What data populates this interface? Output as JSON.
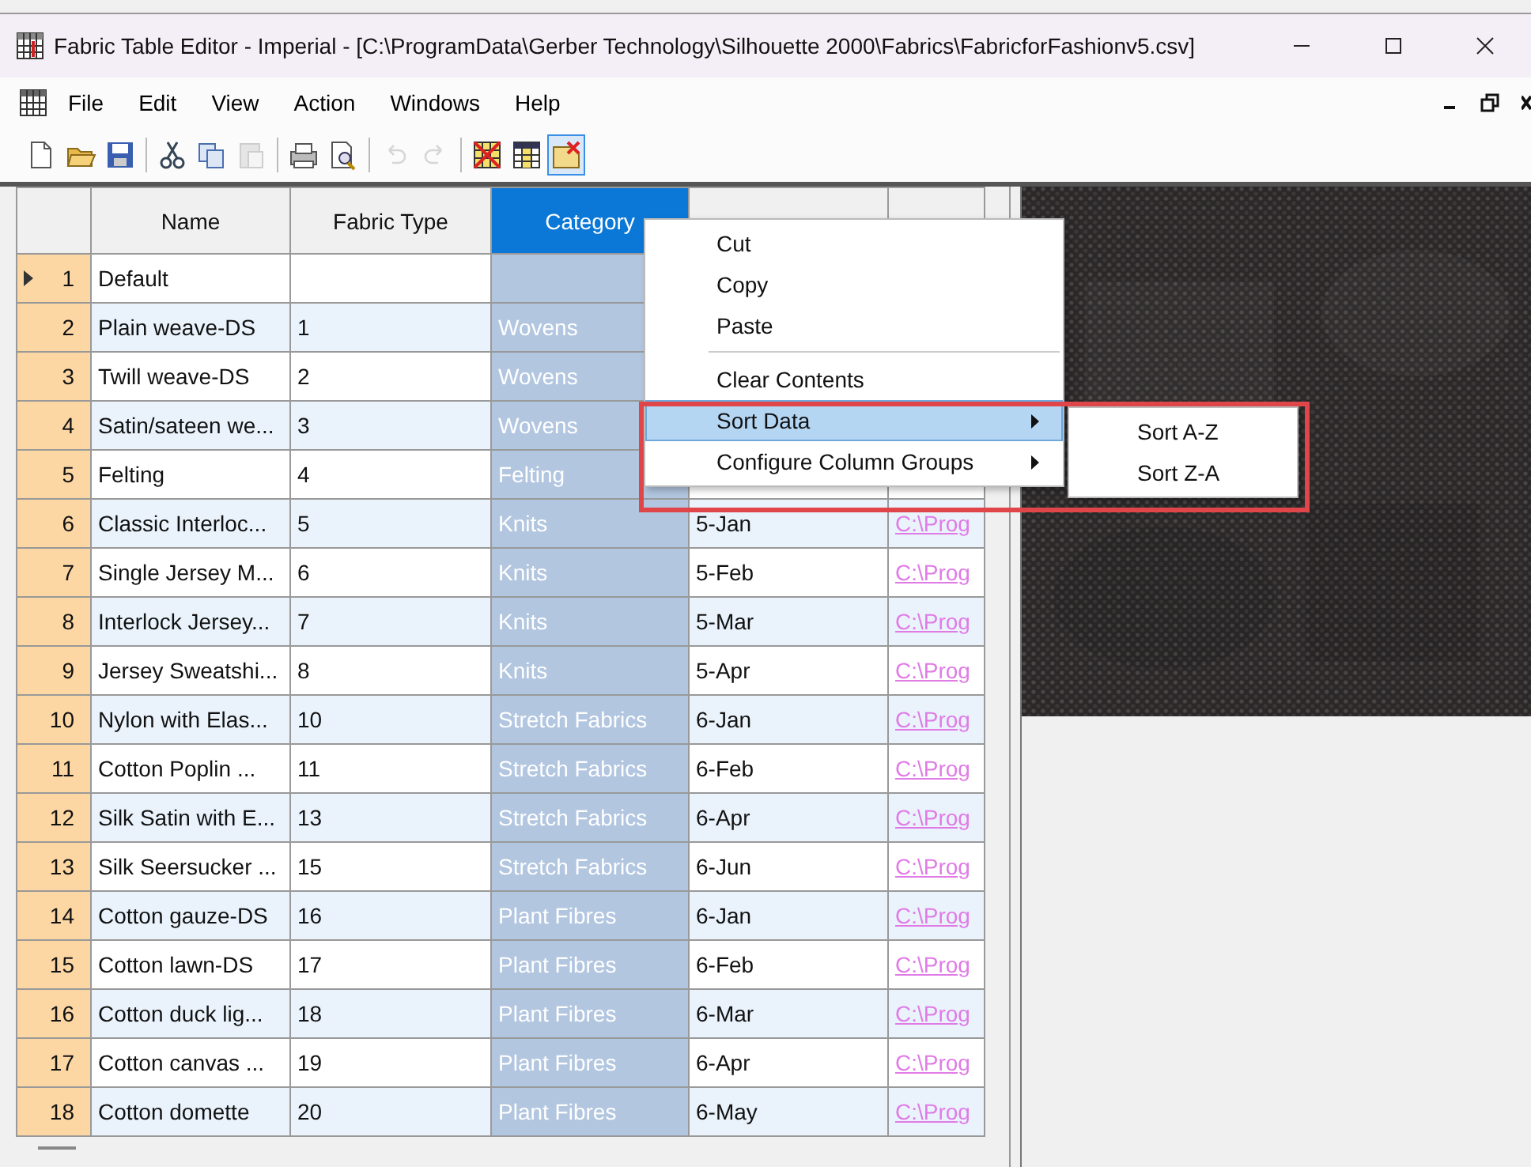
{
  "window": {
    "title": "Fabric Table Editor - Imperial - [C:\\ProgramData\\Gerber Technology\\Silhouette 2000\\Fabrics\\FabricforFashionv5.csv]"
  },
  "menu_bar": [
    "File",
    "Edit",
    "View",
    "Action",
    "Windows",
    "Help"
  ],
  "toolbar": [
    [
      {
        "kind": "new",
        "disabled": false,
        "pressed": false
      },
      {
        "kind": "open",
        "disabled": false,
        "pressed": false
      },
      {
        "kind": "save",
        "disabled": false,
        "pressed": false
      }
    ],
    [
      {
        "kind": "cut",
        "disabled": false,
        "pressed": false
      },
      {
        "kind": "copy",
        "disabled": false,
        "pressed": false
      },
      {
        "kind": "paste",
        "disabled": true,
        "pressed": false
      }
    ],
    [
      {
        "kind": "print",
        "disabled": false,
        "pressed": false
      },
      {
        "kind": "preview",
        "disabled": false,
        "pressed": false
      }
    ],
    [
      {
        "kind": "undo",
        "disabled": true,
        "pressed": false
      },
      {
        "kind": "redo",
        "disabled": true,
        "pressed": false
      }
    ],
    [
      {
        "kind": "grid-delete",
        "disabled": false,
        "pressed": false
      },
      {
        "kind": "columns",
        "disabled": false,
        "pressed": false
      },
      {
        "kind": "note-delete",
        "disabled": false,
        "pressed": true
      }
    ]
  ],
  "table": {
    "columns": [
      {
        "label": "Name",
        "selected": false
      },
      {
        "label": "Fabric Type",
        "selected": false
      },
      {
        "label": "Category",
        "selected": true
      },
      {
        "selected": false
      },
      {
        "selected": false
      }
    ],
    "rows": [
      {
        "number": "1",
        "current": true,
        "cells": [
          "Default",
          null,
          null
        ]
      },
      {
        "number": "2",
        "current": false,
        "cells": [
          "Plain weave-DS",
          "1",
          "Wovens"
        ]
      },
      {
        "number": "3",
        "current": false,
        "cells": [
          "Twill weave-DS",
          "2",
          "Wovens"
        ]
      },
      {
        "number": "4",
        "current": false,
        "cells": [
          "Satin/sateen we...",
          "3",
          "Wovens"
        ]
      },
      {
        "number": "5",
        "current": false,
        "cells": [
          "Felting",
          "4",
          "Felting"
        ]
      },
      {
        "number": "6",
        "current": false,
        "cells": [
          "Classic Interloc...",
          "5",
          "Knits",
          "5-Jan",
          "C:\\Prog"
        ]
      },
      {
        "number": "7",
        "current": false,
        "cells": [
          "Single Jersey M...",
          "6",
          "Knits",
          "5-Feb",
          "C:\\Prog"
        ]
      },
      {
        "number": "8",
        "current": false,
        "cells": [
          "Interlock Jersey...",
          "7",
          "Knits",
          "5-Mar",
          "C:\\Prog"
        ]
      },
      {
        "number": "9",
        "current": false,
        "cells": [
          "Jersey Sweatshi...",
          "8",
          "Knits",
          "5-Apr",
          "C:\\Prog"
        ]
      },
      {
        "number": "10",
        "current": false,
        "cells": [
          "Nylon with Elas...",
          "10",
          "Stretch Fabrics",
          "6-Jan",
          "C:\\Prog"
        ]
      },
      {
        "number": "11",
        "current": false,
        "cells": [
          "Cotton Poplin ...",
          "11",
          "Stretch Fabrics",
          "6-Feb",
          "C:\\Prog"
        ]
      },
      {
        "number": "12",
        "current": false,
        "cells": [
          "Silk Satin with E...",
          "13",
          "Stretch Fabrics",
          "6-Apr",
          "C:\\Prog"
        ]
      },
      {
        "number": "13",
        "current": false,
        "cells": [
          "Silk Seersucker ...",
          "15",
          "Stretch Fabrics",
          "6-Jun",
          "C:\\Prog"
        ]
      },
      {
        "number": "14",
        "current": false,
        "cells": [
          "Cotton gauze-DS",
          "16",
          "Plant Fibres",
          "6-Jan",
          "C:\\Prog"
        ]
      },
      {
        "number": "15",
        "current": false,
        "cells": [
          "Cotton lawn-DS",
          "17",
          "Plant Fibres",
          "6-Feb",
          "C:\\Prog"
        ]
      },
      {
        "number": "16",
        "current": false,
        "cells": [
          "Cotton duck lig...",
          "18",
          "Plant Fibres",
          "6-Mar",
          "C:\\Prog"
        ]
      },
      {
        "number": "17",
        "current": false,
        "cells": [
          "Cotton canvas ...",
          "19",
          "Plant Fibres",
          "6-Apr",
          "C:\\Prog"
        ]
      },
      {
        "number": "18",
        "current": false,
        "cells": [
          "Cotton domette",
          "20",
          "Plant Fibres",
          "6-May",
          "C:\\Prog"
        ]
      }
    ]
  },
  "preview": {
    "kind": "picture"
  },
  "context_menu": {
    "items": [
      {
        "kind": "item",
        "label": "Cut",
        "selected": false,
        "submenu": false
      },
      {
        "kind": "item",
        "label": "Copy",
        "selected": false,
        "submenu": false
      },
      {
        "kind": "item",
        "label": "Paste",
        "selected": false,
        "submenu": false
      },
      {
        "kind": "separator"
      },
      {
        "kind": "item",
        "label": "Clear Contents",
        "selected": false,
        "submenu": false
      },
      {
        "kind": "item",
        "label": "Sort Data",
        "selected": true,
        "submenu": true
      },
      {
        "kind": "item",
        "label": "Configure Column Groups",
        "selected": false,
        "submenu": true
      }
    ],
    "submenu": {
      "items": [
        {
          "label": "Sort A-Z"
        },
        {
          "label": "Sort Z-A"
        }
      ]
    }
  }
}
